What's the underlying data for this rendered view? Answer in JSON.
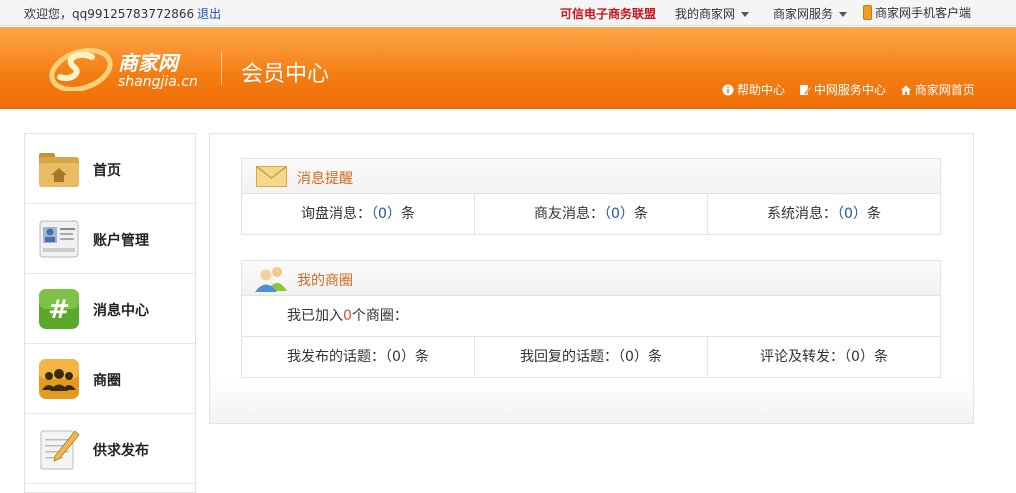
{
  "topbar": {
    "welcome": "欢迎您，qq99125783772866",
    "logout": "退出",
    "alliance": "可信电子商务联盟",
    "my_shangjia": "我的商家网",
    "services": "商家网服务",
    "mobile_client": "商家网手机客户端"
  },
  "header": {
    "logo_cn": "商家网",
    "logo_en": "shangjia.cn",
    "title": "会员中心",
    "links": [
      "帮助中心",
      "中网服务中心",
      "商家网首页"
    ]
  },
  "sidebar": {
    "items": [
      {
        "label": "首页",
        "icon": "folder-home-icon"
      },
      {
        "label": "账户管理",
        "icon": "id-card-icon"
      },
      {
        "label": "消息中心",
        "icon": "hash-icon"
      },
      {
        "label": "商圈",
        "icon": "people-icon"
      },
      {
        "label": "供求发布",
        "icon": "notepad-pencil-icon"
      }
    ]
  },
  "messages": {
    "title": "消息提醒",
    "items": [
      {
        "label": "询盘消息：",
        "count": "（0）",
        "unit": "条"
      },
      {
        "label": "商友消息：",
        "count": "（0）",
        "unit": "条"
      },
      {
        "label": "系统消息：",
        "count": "（0）",
        "unit": "条"
      }
    ]
  },
  "circle": {
    "title": "我的商圈",
    "joined_prefix": "我已加入",
    "joined_count": "0",
    "joined_suffix": "个商圈：",
    "items": [
      {
        "label": "我发布的话题：",
        "count": "（0）",
        "unit": "条"
      },
      {
        "label": "我回复的话题：",
        "count": "（0）",
        "unit": "条"
      },
      {
        "label": "评论及转发：",
        "count": "（0）",
        "unit": "条"
      }
    ]
  },
  "colors": {
    "header_orange": "#f47d12",
    "accent_title": "#d2691e",
    "link_blue": "#1a55a8",
    "alliance_red": "#c8161d"
  }
}
